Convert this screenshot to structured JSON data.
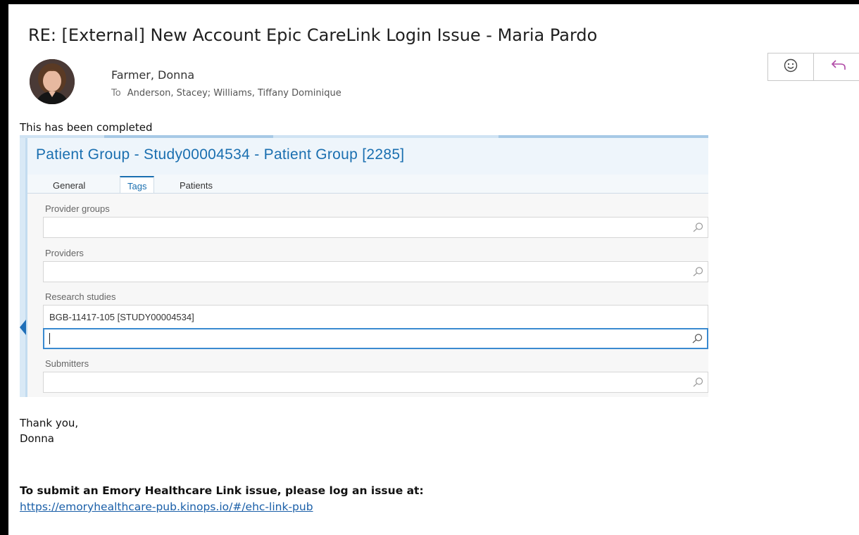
{
  "email": {
    "subject": "RE: [External] New Account Epic CareLink Login Issue - Maria Pardo",
    "sender": "Farmer, Donna",
    "to_label": "To",
    "recipients": "Anderson, Stacey; Williams, Tiffany Dominique",
    "actions": {
      "emoji_icon": "smiley-icon",
      "reply_icon": "reply-arrow-icon"
    },
    "body": {
      "intro": "This has been completed",
      "thanks": "Thank you,",
      "signature": "Donna",
      "submit_title": "To submit an Emory Healthcare Link issue, please log an issue at:",
      "link": "https://emoryhealthcare-pub.kinops.io/#/ehc-link-pub"
    }
  },
  "screenshot": {
    "title": "Patient Group - Study00004534 - Patient Group [2285]",
    "tabs": [
      {
        "label": "General",
        "active": false
      },
      {
        "label": "Tags",
        "active": true
      },
      {
        "label": "Patients",
        "active": false
      }
    ],
    "fields": {
      "provider_groups": {
        "label": "Provider groups",
        "value": ""
      },
      "providers": {
        "label": "Providers",
        "value": ""
      },
      "research_studies": {
        "label": "Research studies",
        "selected": "BGB-11417-105  [STUDY00004534]",
        "value": ""
      },
      "submitters": {
        "label": "Submitters",
        "value": ""
      }
    }
  },
  "colors": {
    "accent": "#1a6fb0",
    "link": "#1a5fa8",
    "reply_icon": "#b04aa6"
  }
}
